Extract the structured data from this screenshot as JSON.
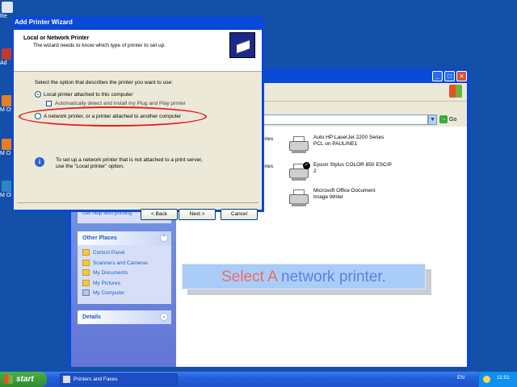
{
  "desktop": {
    "icons": [
      {
        "label": "Re"
      },
      {
        "label": "Ad"
      },
      {
        "label": "M Off"
      },
      {
        "label": "M O"
      },
      {
        "label": "M Ol"
      }
    ]
  },
  "explorer": {
    "see_also": {
      "help_link": "Get help with printing"
    },
    "other_places": {
      "title": "Other Places",
      "links": [
        "Control Panel",
        "Scanners and Cameras",
        "My Documents",
        "My Pictures",
        "My Computer"
      ]
    },
    "details": {
      "title": "Details"
    },
    "go_label": "Go",
    "partial_labels": [
      "eries",
      "eries"
    ],
    "printers": [
      {
        "line1": "Auto HP LaserJet 2200 Series",
        "line2": "PCL on PAULINE1"
      },
      {
        "line1": "Epson Stylus COLOR 850 ESC/P",
        "line2": "2"
      },
      {
        "line1": "Microsoft Office Document",
        "line2": "Image Writer"
      }
    ]
  },
  "wizard": {
    "title": "Add Printer Wizard",
    "header_title": "Local or Network Printer",
    "header_subtitle": "The wizard needs to know which type of printer to set up.",
    "prompt": "Select the option that describes the printer you want to use:",
    "option_local": "Local printer attached to this computer",
    "checkbox_label": "Automatically detect and install my Plug and Play printer",
    "option_network": "A network printer, or a printer attached to another computer",
    "selected_option": "local",
    "info_line1": "To set up a network printer that is not attached to a print server,",
    "info_line2": "use the \"Local printer\" option.",
    "buttons": {
      "back": "< Back",
      "next": "Next >",
      "cancel": "Cancel"
    }
  },
  "caption": {
    "part1": "Select A",
    "part2": " network printer."
  },
  "taskbar": {
    "start": "start",
    "task_item": "Printers and Faxes",
    "lang": "EN",
    "clock": "11:51"
  }
}
